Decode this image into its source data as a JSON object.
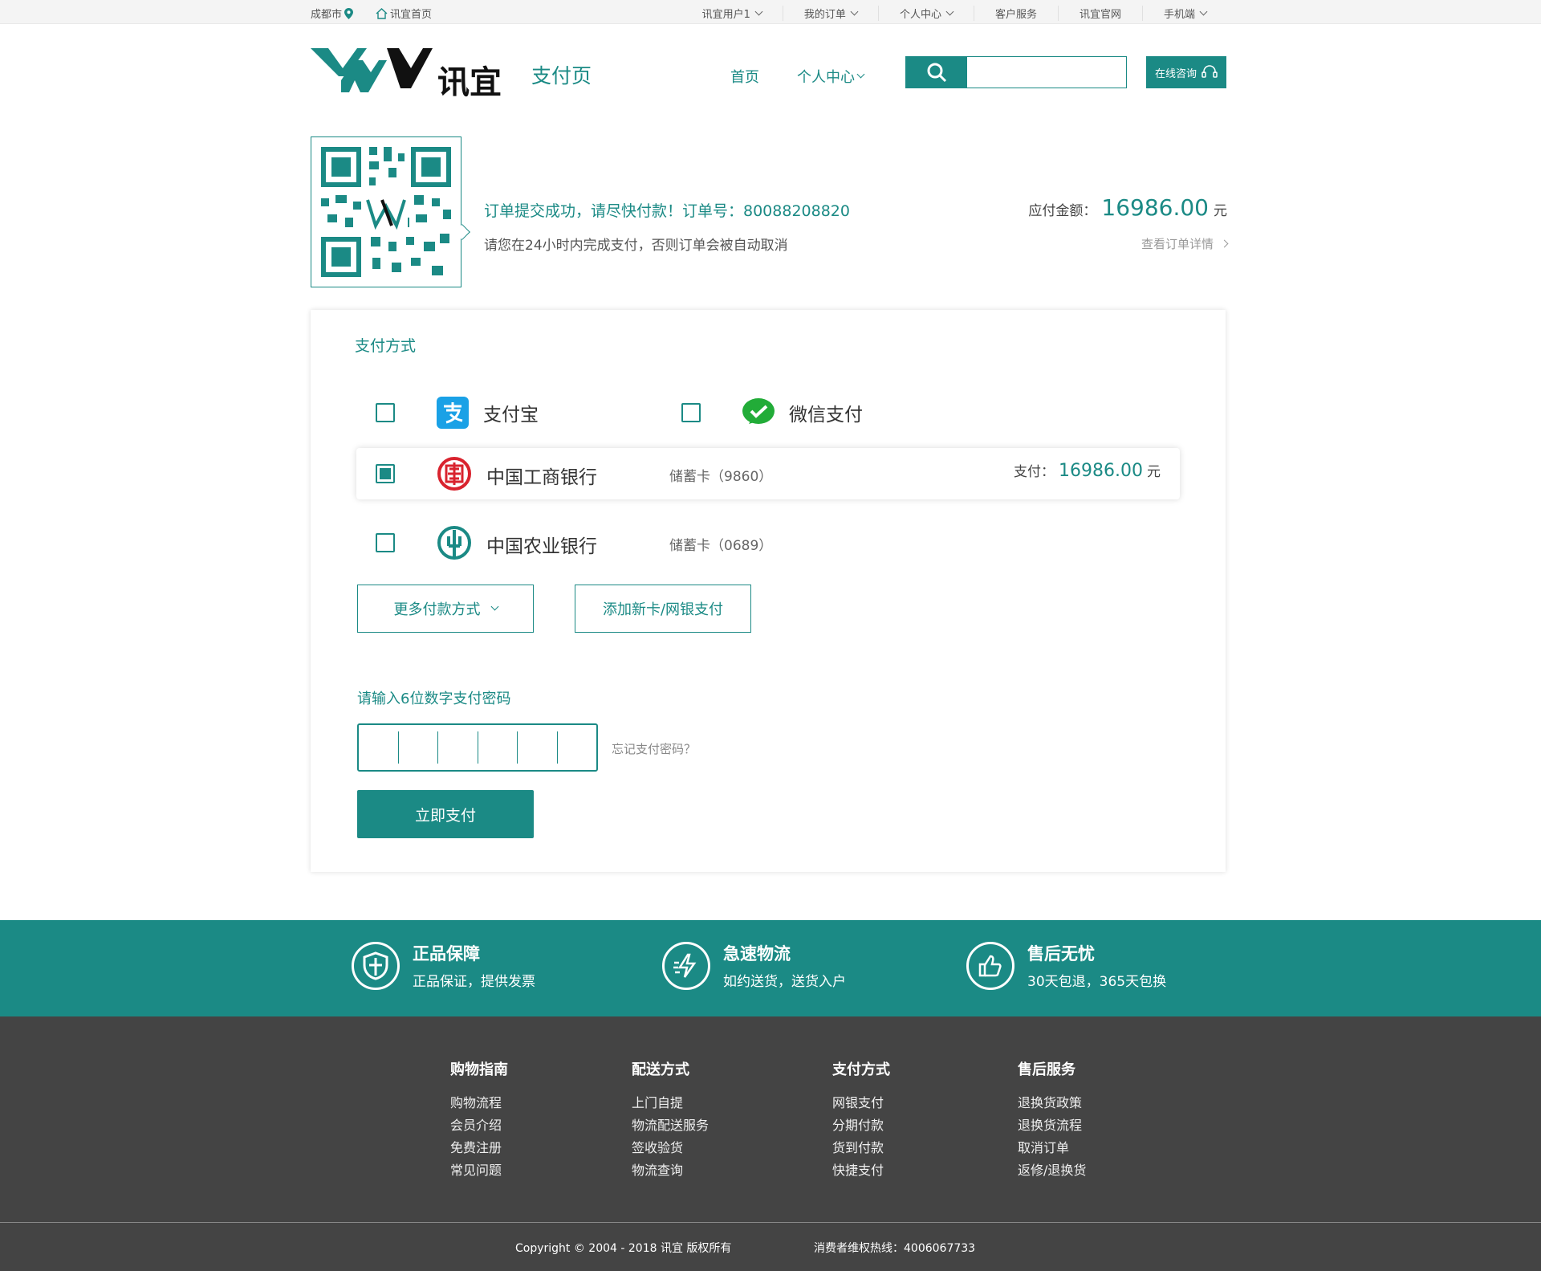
{
  "topbar": {
    "city": "成都市",
    "home_link": "讯宜首页",
    "links": [
      "讯宜用户1",
      "我的订单",
      "个人中心",
      "客户服务",
      "讯宜官网",
      "手机端"
    ]
  },
  "header": {
    "brand": "讯宜",
    "page_name": "支付页",
    "nav_home": "首页",
    "nav_personal": "个人中心",
    "search_placeholder": "",
    "consult_label": "在线咨询"
  },
  "order": {
    "message": "订单提交成功，请尽快付款！订单号：80088208820",
    "notice": "请您在24小时内完成支付，否则订单会被自动取消",
    "amount_label": "应付金额：",
    "amount": "16986.00",
    "currency": "元",
    "detail_link": "查看订单详情"
  },
  "payment": {
    "title": "支付方式",
    "alipay_label": "支付宝",
    "wechat_label": "微信支付",
    "banks": [
      {
        "name": "中国工商银行",
        "card": "储蓄卡（9860）",
        "selected": true,
        "pay_label": "支付：",
        "pay_amount": "16986.00",
        "currency": "元"
      },
      {
        "name": "中国农业银行",
        "card": "储蓄卡（0689）",
        "selected": false
      }
    ],
    "more_label": "更多付款方式",
    "add_card_label": "添加新卡/网银支付",
    "password_label": "请输入6位数字支付密码",
    "forgot_label": "忘记支付密码？",
    "pay_now_label": "立即支付"
  },
  "features": [
    {
      "title": "正品保障",
      "desc": "正品保证，提供发票",
      "icon": "shield-icon"
    },
    {
      "title": "急速物流",
      "desc": "如约送货，送货入户",
      "icon": "lightning-icon"
    },
    {
      "title": "售后无忧",
      "desc": "30天包退，365天包换",
      "icon": "thumbs-up-icon"
    }
  ],
  "footer": {
    "columns": [
      {
        "title": "购物指南",
        "links": [
          "购物流程",
          "会员介绍",
          "免费注册",
          "常见问题"
        ]
      },
      {
        "title": "配送方式",
        "links": [
          "上门自提",
          "物流配送服务",
          "签收验货",
          "物流查询"
        ]
      },
      {
        "title": "支付方式",
        "links": [
          "网银支付",
          "分期付款",
          "货到付款",
          "快捷支付"
        ]
      },
      {
        "title": "售后服务",
        "links": [
          "退换货政策",
          "退换货流程",
          "取消订单",
          "返修/退换货"
        ]
      }
    ],
    "copyright": "Copyright © 2004 - 2018  讯宜 版权所有",
    "hotline": "消费者维权热线：4006067733"
  },
  "colors": {
    "accent": "#1b8a85",
    "footer_bg": "#444444"
  }
}
